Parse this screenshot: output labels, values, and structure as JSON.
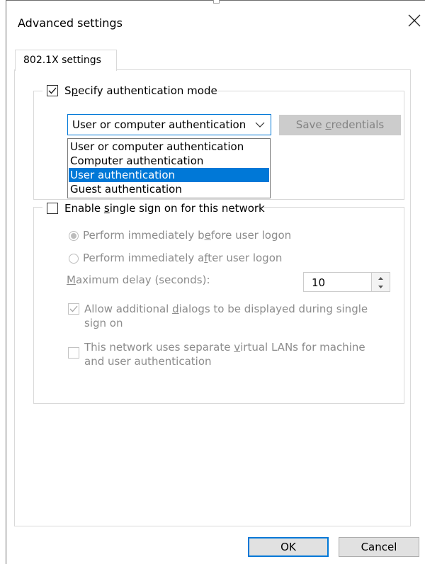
{
  "window": {
    "title": "Advanced settings",
    "close_icon": "close-icon"
  },
  "tab": {
    "label": "802.1X settings"
  },
  "auth_group": {
    "checkbox_checked": true,
    "label_pre": "S",
    "label_u": "p",
    "label_post": "ecify authentication mode",
    "select_value": "User or computer authentication",
    "dropdown_icon": "chevron-down-icon",
    "save_pre": "Save ",
    "save_u": "c",
    "save_post": "redentials",
    "options": [
      "User or computer authentication",
      "Computer authentication",
      "User authentication",
      "Guest authentication"
    ],
    "highlighted_option": "User authentication"
  },
  "sso_group": {
    "checkbox_checked": false,
    "label_pre": "Enable ",
    "label_u": "s",
    "label_post": "ingle sign on for this network",
    "radio_before_pre": "Perform immediately b",
    "radio_before_u": "e",
    "radio_before_post": "fore user logon",
    "radio_before_selected": true,
    "radio_after_pre": "Perform immediately a",
    "radio_after_u": "f",
    "radio_after_post": "ter user logon",
    "delay_u": "M",
    "delay_post": "aximum delay (seconds):",
    "delay_value": "10",
    "allow_pre": "Allow additional ",
    "allow_u": "d",
    "allow_post": "ialogs to be displayed during single",
    "allow_line2": "sign on",
    "allow_checked": true,
    "vlan_pre": "This network uses separate ",
    "vlan_u": "v",
    "vlan_post": "irtual LANs for machine",
    "vlan_line2": "and user authentication",
    "vlan_checked": false
  },
  "buttons": {
    "ok": "OK",
    "cancel": "Cancel"
  },
  "colors": {
    "accent": "#0078d7",
    "disabled_text": "#8c8c8c"
  }
}
